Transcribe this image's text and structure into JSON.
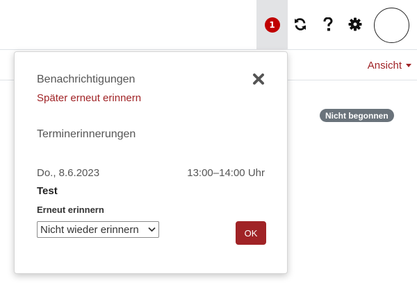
{
  "header": {
    "notifications_count": "1",
    "sync_icon": "sync-icon",
    "help_icon": "question-icon",
    "settings_icon": "gear-icon"
  },
  "subheader": {
    "view_label": "Ansicht"
  },
  "content": {
    "status_badge": "Nicht begonnen"
  },
  "popover": {
    "title": "Benachrichtigungen",
    "snooze_link": "Später erneut erinnern",
    "section_title": "Terminerinnerungen",
    "event": {
      "date": "Do., 8.6.2023",
      "time": "13:00–14:00 Uhr",
      "name": "Test"
    },
    "remind_label": "Erneut erinnern",
    "remind_selected": "Nicht wieder erinnern",
    "ok_label": "OK"
  },
  "colors": {
    "accent": "#a02326",
    "badge": "#c00000",
    "status_pill": "#6a737b"
  }
}
